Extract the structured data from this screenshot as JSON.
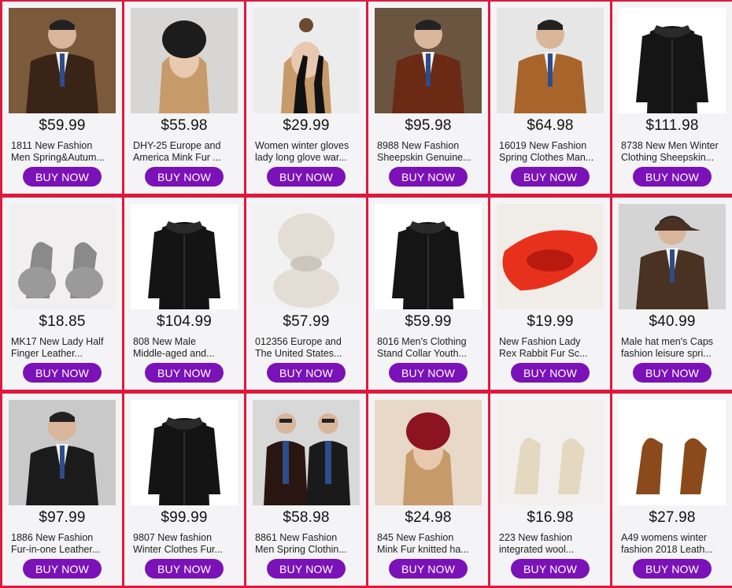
{
  "button_label": "BUY NOW",
  "products": [
    {
      "price": "$59.99",
      "title_line1": "1811 New Fashion",
      "title_line2": "Men Spring&Autum...",
      "image": "man-brown-leather-jacket",
      "bg": "#7a5a3a",
      "fg": "#3a2418"
    },
    {
      "price": "$55.98",
      "title_line1": "DHY-25 Europe and",
      "title_line2": "America Mink Fur ...",
      "image": "woman-fur-hat",
      "bg": "#d8d6d4",
      "fg": "#222222"
    },
    {
      "price": "$29.99",
      "title_line1": "Women winter gloves",
      "title_line2": "lady long glove war...",
      "image": "woman-long-gloves",
      "bg": "#ececec",
      "fg": "#111111"
    },
    {
      "price": "$95.98",
      "title_line1": "8988 New Fashion",
      "title_line2": "Sheepskin Genuine...",
      "image": "man-shearling-jacket",
      "bg": "#6b5440",
      "fg": "#6b2a14"
    },
    {
      "price": "$64.98",
      "title_line1": "16019 New Fashion",
      "title_line2": "Spring Clothes Man...",
      "image": "man-tan-leather-jacket",
      "bg": "#e6e6e6",
      "fg": "#a8642a"
    },
    {
      "price": "$111.98",
      "title_line1": "8738 New Men Winter",
      "title_line2": "Clothing Sheepskin...",
      "image": "black-fur-collar-coat",
      "bg": "#ffffff",
      "fg": "#151515"
    },
    {
      "price": "$18.85",
      "title_line1": "MK17 New Lady Half",
      "title_line2": "Finger Leather...",
      "image": "grey-fur-gloves",
      "bg": "#f1efef",
      "fg": "#8a8a8a"
    },
    {
      "price": "$104.99",
      "title_line1": "808 New Male",
      "title_line2": "Middle-aged and...",
      "image": "black-long-leather-coat",
      "bg": "#ffffff",
      "fg": "#141414"
    },
    {
      "price": "$57.99",
      "title_line1": "012356 Europe and",
      "title_line2": "The United States...",
      "image": "white-fur-hat-scarf",
      "bg": "#f2f2f2",
      "fg": "#e3ddd6"
    },
    {
      "price": "$59.99",
      "title_line1": "8016 Men's Clothing",
      "title_line2": "Stand Collar Youth...",
      "image": "black-leather-jacket",
      "bg": "#ffffff",
      "fg": "#151515"
    },
    {
      "price": "$19.99",
      "title_line1": "New Fashion Lady",
      "title_line2": "Rex Rabbit Fur Sc...",
      "image": "red-fur-scarf",
      "bg": "#f0ece8",
      "fg": "#e8311c"
    },
    {
      "price": "$40.99",
      "title_line1": "Male hat men's Caps",
      "title_line2": "fashion leisure spri...",
      "image": "man-leather-cap",
      "bg": "#d4d4d4",
      "fg": "#4a3222"
    },
    {
      "price": "$97.99",
      "title_line1": "1886 New Fashion",
      "title_line2": "Fur-in-one Leather...",
      "image": "man-black-leather-coat",
      "bg": "#c9c9c9",
      "fg": "#1b1b1b"
    },
    {
      "price": "$99.99",
      "title_line1": "9807 New fashion",
      "title_line2": "Winter Clothes Fur...",
      "image": "black-fur-collar-jacket",
      "bg": "#ffffff",
      "fg": "#141414"
    },
    {
      "price": "$58.98",
      "title_line1": "8861 New Fashion",
      "title_line2": "Men Spring Clothin...",
      "image": "two-men-leather-jackets",
      "bg": "#d8d8d8",
      "fg": "#2a1610"
    },
    {
      "price": "$24.98",
      "title_line1": "845 New Fashion",
      "title_line2": "Mink Fur knitted ha...",
      "image": "woman-red-knit-hat",
      "bg": "#e8d8c8",
      "fg": "#8c1420"
    },
    {
      "price": "$16.98",
      "title_line1": "223 New fashion",
      "title_line2": "integrated wool...",
      "image": "sheepskin-gloves",
      "bg": "#f2f0ee",
      "fg": "#e4d8c0"
    },
    {
      "price": "$27.98",
      "title_line1": "A49 womens winter",
      "title_line2": "fashion 2018 Leath...",
      "image": "leopard-gloves",
      "bg": "#ffffff",
      "fg": "#8a4a1c"
    }
  ]
}
